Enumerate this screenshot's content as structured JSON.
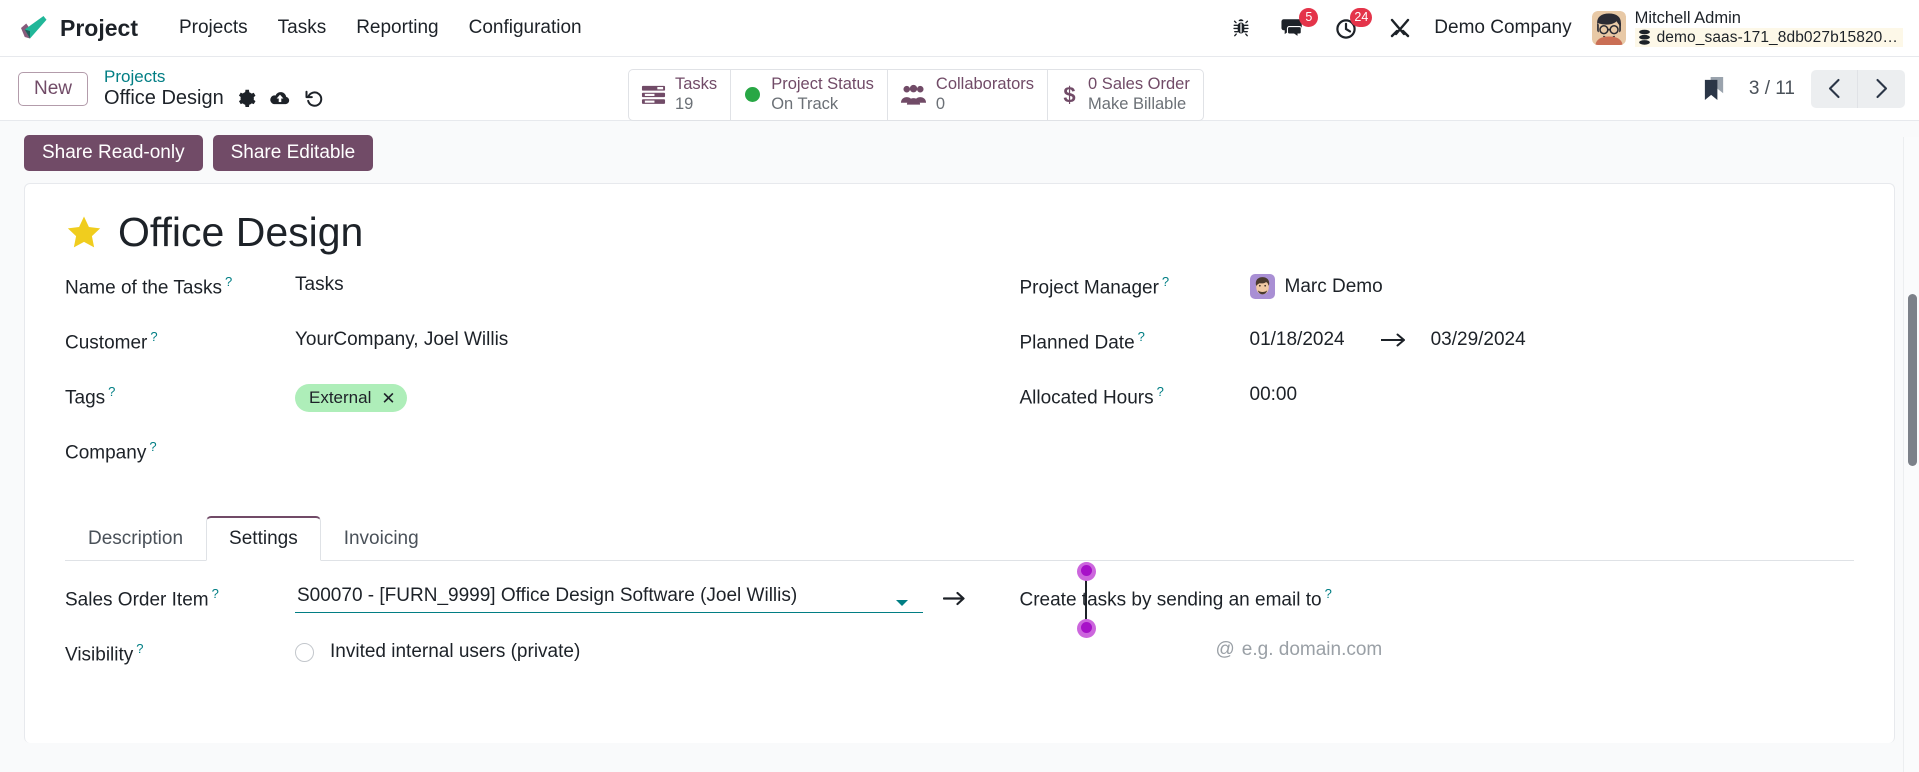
{
  "navbar": {
    "brand": "Project",
    "menu": [
      {
        "label": "Projects",
        "name": "nav-projects"
      },
      {
        "label": "Tasks",
        "name": "nav-tasks"
      },
      {
        "label": "Reporting",
        "name": "nav-reporting"
      },
      {
        "label": "Configuration",
        "name": "nav-configuration"
      }
    ],
    "icons": {
      "bug": "bug-icon",
      "messages": "messages-icon",
      "activities": "activities-clock-icon",
      "tools": "tools-icon"
    },
    "messages_count": "5",
    "activities_count": "24",
    "company": "Demo Company",
    "user_name": "Mitchell Admin",
    "database": "demo_saas-171_8db027b15820…",
    "badge_color": "#e4344a"
  },
  "control_panel": {
    "new_label": "New",
    "breadcrumb_parent": "Projects",
    "breadcrumb_current": "Office Design",
    "icons": {
      "settings": "gear-icon",
      "upload": "cloud-upload-icon",
      "discard": "undo-icon",
      "bookmark": "bookmark-icon",
      "prev": "chevron-left-icon",
      "next": "chevron-right-icon"
    },
    "pager": "3 / 11",
    "stat_buttons": [
      {
        "name": "stat-tasks",
        "icon": "list-icon",
        "line1": "Tasks",
        "line2": "19"
      },
      {
        "name": "stat-project-status",
        "icon": "status-dot-icon",
        "line1": "Project Status",
        "line2": "On Track",
        "dot_color": "#28a745"
      },
      {
        "name": "stat-collaborators",
        "icon": "people-icon",
        "line1": "Collaborators",
        "line2": "0"
      },
      {
        "name": "stat-sales-order",
        "icon": "dollar-icon",
        "line1": "0 Sales Order",
        "line2": "Make Billable"
      }
    ]
  },
  "statusbar": {
    "share_readonly": "Share Read-only",
    "share_editable": "Share Editable",
    "button_color": "#714b67"
  },
  "record": {
    "favorite_icon": "star-icon",
    "title": "Office Design",
    "left_fields": [
      {
        "name": "field-task-label",
        "label": "Name of the Tasks",
        "value": "Tasks"
      },
      {
        "name": "field-customer",
        "label": "Customer",
        "value": "YourCompany, Joel Willis"
      },
      {
        "name": "field-tags",
        "label": "Tags",
        "value": "External",
        "tag_color": "#aeeeb9"
      },
      {
        "name": "field-company",
        "label": "Company",
        "value": ""
      }
    ],
    "right_fields": [
      {
        "name": "field-project-manager",
        "label": "Project Manager",
        "value": "Marc Demo"
      },
      {
        "name": "field-planned-date",
        "label": "Planned Date",
        "value": "01/18/2024",
        "value2": "03/29/2024"
      },
      {
        "name": "field-allocated-hours",
        "label": "Allocated Hours",
        "value": "00:00"
      }
    ]
  },
  "notebook": {
    "tabs": [
      {
        "label": "Description",
        "name": "tab-description",
        "active": false
      },
      {
        "label": "Settings",
        "name": "tab-settings",
        "active": true
      },
      {
        "label": "Invoicing",
        "name": "tab-invoicing",
        "active": false
      }
    ],
    "settings": {
      "sales_order_item_label": "Sales Order Item",
      "sales_order_item_value": "S00070 - [FURN_9999] Office Design Software (Joel Willis)",
      "visibility_label": "Visibility",
      "visibility_option": "Invited internal users (private)",
      "email_alias_label": "Create tasks by sending an email to",
      "email_alias_at": "@",
      "email_alias_placeholder": "e.g. domain.com"
    }
  },
  "help_marker": "?"
}
